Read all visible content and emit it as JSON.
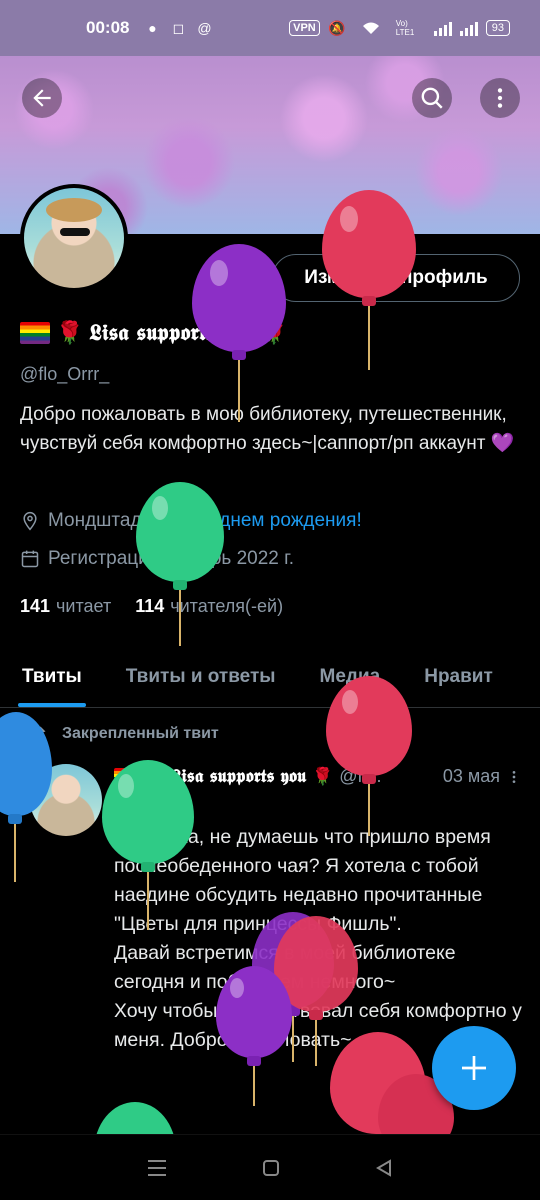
{
  "status_bar": {
    "time": "00:08",
    "vpn": "VPN",
    "network": "Vo) LTE1",
    "battery": "93"
  },
  "header": {
    "back_icon": "arrow-left-icon",
    "search_icon": "search-icon",
    "more_icon": "more-vertical-icon"
  },
  "profile": {
    "edit_button": "Изменить профиль",
    "display_name": "𝕷𝖎𝖘𝖆 𝖘𝖚𝖕𝖕𝖔𝖗𝖙𝖘 𝖞𝖔𝖚",
    "handle": "@flo_Orrr_",
    "bio": "Добро пожаловать в мою библиотеку, путешественник, чувствуй себя комфортно здесь~|саппорт/рп аккаунт 💜",
    "location": "Мондштадт",
    "birthday": "С днем рождения!",
    "joined": "Регистрация: январь 2022 г.",
    "following_count": "141",
    "following_label": "читает",
    "followers_count": "114",
    "followers_label": "читателя(-ей)"
  },
  "tabs": [
    {
      "label": "Твиты",
      "active": true
    },
    {
      "label": "Твиты и ответы",
      "active": false
    },
    {
      "label": "Медиа",
      "active": false
    },
    {
      "label": "Нравит",
      "active": false
    }
  ],
  "pinned_tweet": {
    "pinned_label": "Закрепленный твит",
    "author_name": "𝕷𝖎𝖘𝖆 𝖘𝖚𝖕𝖕𝖔𝖗𝖙𝖘 𝖞𝖔𝖚",
    "author_handle": "@fl...",
    "date": "03 мая",
    "text": "Хи-хи~\nМилашка, не думаешь что пришло время послеобеденного чая? Я хотела с тобой наедине обсудить недавно прочитанные \"Цветы для принцессы Фишль\".\nДавай встретимся в моей библиотеке сегодня и поболтаем немного~\nХочу чтобы ты чувствовал себя комфортно у меня. Добро пожаловать~"
  },
  "colors": {
    "accent": "#1d9bf0",
    "background": "#000000",
    "secondary_text": "#8b98a5",
    "status_bar": "#8b7ba8"
  }
}
